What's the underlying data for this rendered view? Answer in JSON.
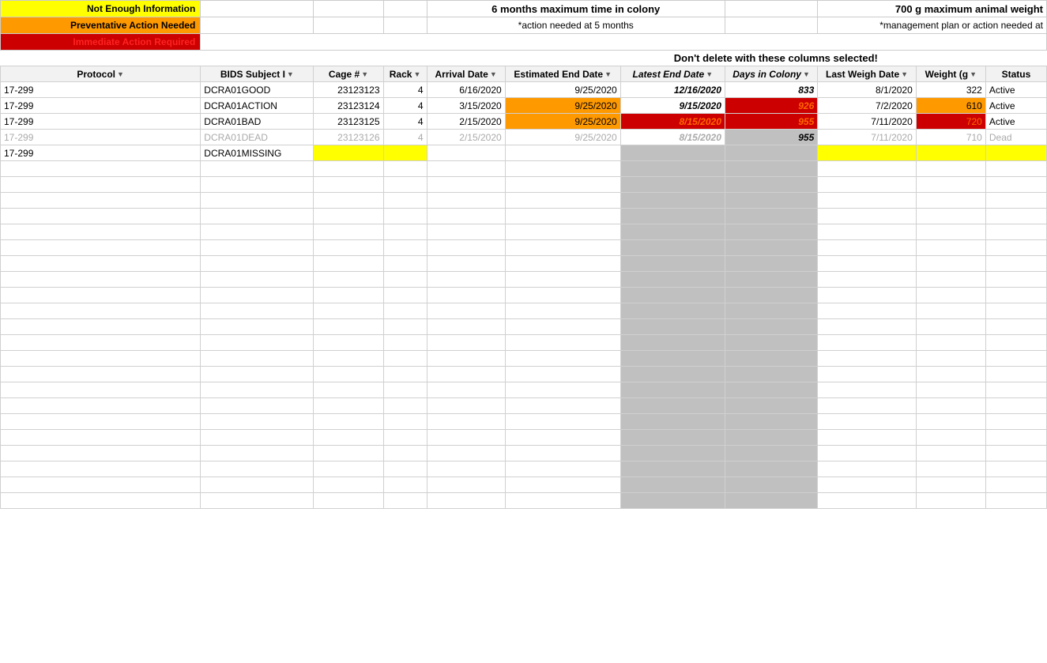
{
  "legend": {
    "items": [
      {
        "label": "Not Enough Information",
        "color": "yellow"
      },
      {
        "label": "Preventative Action Needed",
        "color": "orange"
      },
      {
        "label": "Immediate Action Required",
        "color": "red"
      }
    ],
    "center_text_line1": "6 months maximum time in colony",
    "center_text_line2": "*action needed at 5 months",
    "right_text_line1": "700 g maximum animal weight",
    "right_text_line2": "*management plan or action needed at"
  },
  "warning": "Don't delete with these columns selected!",
  "columns": [
    {
      "key": "protocol",
      "label": "Protocol",
      "filter": true
    },
    {
      "key": "bids",
      "label": "BIDS Subject I",
      "filter": true
    },
    {
      "key": "cage",
      "label": "Cage #",
      "filter": true
    },
    {
      "key": "rack",
      "label": "Rack",
      "filter": true
    },
    {
      "key": "arrival",
      "label": "Arrival Date",
      "filter": true
    },
    {
      "key": "est_end",
      "label": "Estimated End Date",
      "filter": true
    },
    {
      "key": "latest_end",
      "label": "Latest End Date",
      "filter": true
    },
    {
      "key": "days",
      "label": "Days in Colony",
      "filter": true
    },
    {
      "key": "last_weigh",
      "label": "Last Weigh Date",
      "filter": true
    },
    {
      "key": "weight",
      "label": "Weight (g",
      "filter": true
    },
    {
      "key": "status",
      "label": "Status",
      "filter": false
    }
  ],
  "rows": [
    {
      "protocol": "17-299",
      "bids": "DCRA01GOOD",
      "cage": "23123123",
      "rack": "4",
      "arrival": "6/16/2020",
      "est_end": "9/25/2020",
      "latest_end": "12/16/2020",
      "days": "833",
      "last_weigh": "8/1/2020",
      "weight": "322",
      "status": "Active",
      "type": "good"
    },
    {
      "protocol": "17-299",
      "bids": "DCRA01ACTION",
      "cage": "23123124",
      "rack": "4",
      "arrival": "3/15/2020",
      "est_end": "9/25/2020",
      "latest_end": "9/15/2020",
      "days": "926",
      "last_weigh": "7/2/2020",
      "weight": "610",
      "status": "Active",
      "type": "action"
    },
    {
      "protocol": "17-299",
      "bids": "DCRA01BAD",
      "cage": "23123125",
      "rack": "4",
      "arrival": "2/15/2020",
      "est_end": "9/25/2020",
      "latest_end": "8/15/2020",
      "days": "955",
      "last_weigh": "7/11/2020",
      "weight": "720",
      "status": "Active",
      "type": "bad"
    },
    {
      "protocol": "17-299",
      "bids": "DCRA01DEAD",
      "cage": "23123126",
      "rack": "4",
      "arrival": "2/15/2020",
      "est_end": "9/25/2020",
      "latest_end": "8/15/2020",
      "days": "955",
      "last_weigh": "7/11/2020",
      "weight": "710",
      "status": "Dead",
      "type": "dead"
    },
    {
      "protocol": "17-299",
      "bids": "DCRA01MISSING",
      "cage": "",
      "rack": "",
      "arrival": "",
      "est_end": "",
      "latest_end": "",
      "days": "",
      "last_weigh": "",
      "weight": "",
      "status": "",
      "type": "missing"
    }
  ]
}
